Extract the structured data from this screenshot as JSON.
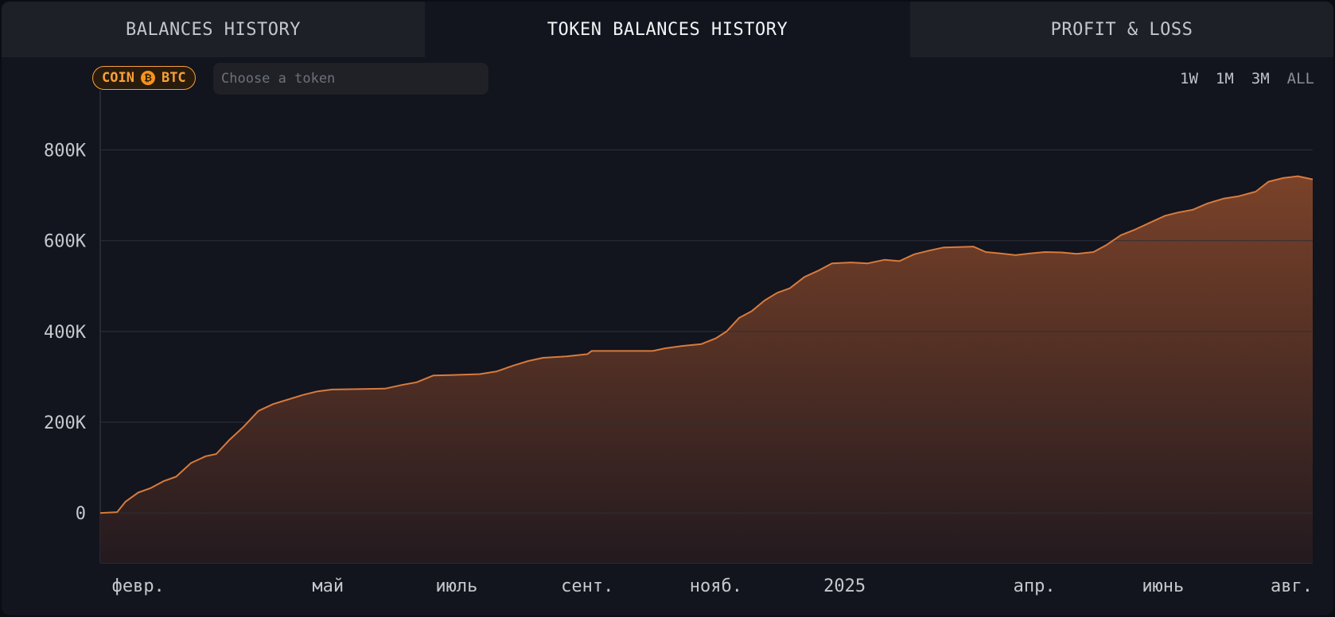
{
  "tabs": [
    {
      "label": "BALANCES HISTORY",
      "active": false
    },
    {
      "label": "TOKEN BALANCES HISTORY",
      "active": true
    },
    {
      "label": "PROFIT & LOSS",
      "active": false
    }
  ],
  "filter": {
    "chip_type": "COIN",
    "chip_icon": "bitcoin-icon",
    "chip_token": "BTC",
    "token_placeholder": "Choose a token"
  },
  "ranges": [
    {
      "label": "1W",
      "active": false
    },
    {
      "label": "1M",
      "active": false
    },
    {
      "label": "3M",
      "active": false
    },
    {
      "label": "ALL",
      "active": true
    }
  ],
  "colors": {
    "accent": "#f7a13a",
    "line": "#d87a3c",
    "area_top": "#7a4229",
    "area_bottom": "#231a1f",
    "grid": "#2e303a",
    "background": "#12141e"
  },
  "chart_data": {
    "type": "area",
    "title": "",
    "xlabel": "",
    "ylabel": "",
    "ylim": [
      -110000,
      920000
    ],
    "yticks": [
      {
        "value": 0,
        "label": "0"
      },
      {
        "value": 200000,
        "label": "200K"
      },
      {
        "value": 400000,
        "label": "400K"
      },
      {
        "value": 600000,
        "label": "600K"
      },
      {
        "value": 800000,
        "label": "800K"
      }
    ],
    "xlim": [
      "2024-01-14",
      "2025-08-11"
    ],
    "xticks": [
      {
        "value": "2024-02-01",
        "label": "февр."
      },
      {
        "value": "2024-05-01",
        "label": "май"
      },
      {
        "value": "2024-07-01",
        "label": "июль"
      },
      {
        "value": "2024-09-01",
        "label": "сент."
      },
      {
        "value": "2024-11-01",
        "label": "нояб."
      },
      {
        "value": "2025-01-01",
        "label": "2025"
      },
      {
        "value": "2025-04-01",
        "label": "апр."
      },
      {
        "value": "2025-06-01",
        "label": "июнь"
      },
      {
        "value": "2025-08-01",
        "label": "авг."
      }
    ],
    "grid": true,
    "series": [
      {
        "points": [
          [
            "2024-01-14",
            0
          ],
          [
            "2024-01-22",
            2000
          ],
          [
            "2024-01-26",
            25000
          ],
          [
            "2024-02-01",
            45000
          ],
          [
            "2024-02-07",
            55000
          ],
          [
            "2024-02-13",
            70000
          ],
          [
            "2024-02-19",
            80000
          ],
          [
            "2024-02-26",
            110000
          ],
          [
            "2024-03-04",
            125000
          ],
          [
            "2024-03-09",
            130000
          ],
          [
            "2024-03-15",
            160000
          ],
          [
            "2024-03-22",
            190000
          ],
          [
            "2024-03-29",
            225000
          ],
          [
            "2024-04-05",
            240000
          ],
          [
            "2024-04-12",
            250000
          ],
          [
            "2024-04-19",
            260000
          ],
          [
            "2024-04-26",
            268000
          ],
          [
            "2024-05-03",
            272000
          ],
          [
            "2024-05-15",
            273000
          ],
          [
            "2024-05-28",
            274000
          ],
          [
            "2024-06-05",
            282000
          ],
          [
            "2024-06-12",
            288000
          ],
          [
            "2024-06-20",
            303000
          ],
          [
            "2024-06-28",
            304000
          ],
          [
            "2024-07-12",
            306000
          ],
          [
            "2024-07-20",
            312000
          ],
          [
            "2024-07-28",
            325000
          ],
          [
            "2024-08-04",
            335000
          ],
          [
            "2024-08-11",
            342000
          ],
          [
            "2024-08-22",
            345000
          ],
          [
            "2024-09-01",
            350000
          ],
          [
            "2024-09-03",
            357000
          ],
          [
            "2024-09-20",
            357000
          ],
          [
            "2024-10-02",
            357000
          ],
          [
            "2024-10-08",
            363000
          ],
          [
            "2024-10-16",
            368000
          ],
          [
            "2024-10-25",
            372000
          ],
          [
            "2024-11-01",
            385000
          ],
          [
            "2024-11-06",
            400000
          ],
          [
            "2024-11-12",
            430000
          ],
          [
            "2024-11-18",
            445000
          ],
          [
            "2024-11-24",
            468000
          ],
          [
            "2024-11-30",
            485000
          ],
          [
            "2024-12-06",
            495000
          ],
          [
            "2024-12-13",
            520000
          ],
          [
            "2024-12-20",
            535000
          ],
          [
            "2024-12-26",
            550000
          ],
          [
            "2025-01-04",
            552000
          ],
          [
            "2025-01-12",
            550000
          ],
          [
            "2025-01-20",
            558000
          ],
          [
            "2025-01-27",
            555000
          ],
          [
            "2025-02-03",
            570000
          ],
          [
            "2025-02-10",
            578000
          ],
          [
            "2025-02-17",
            585000
          ],
          [
            "2025-02-24",
            586000
          ],
          [
            "2025-03-03",
            587000
          ],
          [
            "2025-03-09",
            575000
          ],
          [
            "2025-03-16",
            572000
          ],
          [
            "2025-03-23",
            568000
          ],
          [
            "2025-03-30",
            572000
          ],
          [
            "2025-04-06",
            575000
          ],
          [
            "2025-04-14",
            574000
          ],
          [
            "2025-04-21",
            571000
          ],
          [
            "2025-04-29",
            575000
          ],
          [
            "2025-05-05",
            590000
          ],
          [
            "2025-05-12",
            612000
          ],
          [
            "2025-05-19",
            625000
          ],
          [
            "2025-05-26",
            640000
          ],
          [
            "2025-06-02",
            655000
          ],
          [
            "2025-06-08",
            662000
          ],
          [
            "2025-06-15",
            668000
          ],
          [
            "2025-06-22",
            682000
          ],
          [
            "2025-06-30",
            693000
          ],
          [
            "2025-07-07",
            698000
          ],
          [
            "2025-07-15",
            708000
          ],
          [
            "2025-07-21",
            730000
          ],
          [
            "2025-07-28",
            738000
          ],
          [
            "2025-08-04",
            742000
          ],
          [
            "2025-08-08",
            738000
          ],
          [
            "2025-08-11",
            735000
          ]
        ]
      }
    ]
  }
}
